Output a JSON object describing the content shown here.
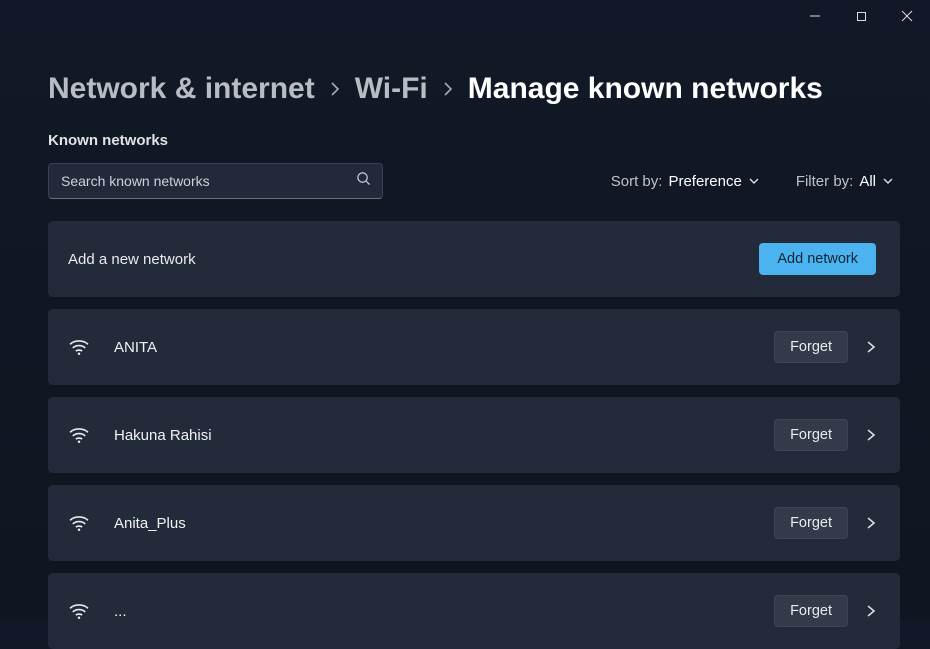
{
  "breadcrumb": {
    "items": [
      "Network & internet",
      "Wi-Fi",
      "Manage known networks"
    ]
  },
  "section_title": "Known networks",
  "search": {
    "placeholder": "Search known networks",
    "value": ""
  },
  "sort": {
    "label": "Sort by:",
    "value": "Preference"
  },
  "filter": {
    "label": "Filter by:",
    "value": "All"
  },
  "add_row": {
    "label": "Add a new network",
    "button": "Add network"
  },
  "forget_label": "Forget",
  "networks": [
    {
      "name": "ANITA"
    },
    {
      "name": "Hakuna Rahisi"
    },
    {
      "name": "Anita_Plus"
    },
    {
      "name": "..."
    }
  ]
}
